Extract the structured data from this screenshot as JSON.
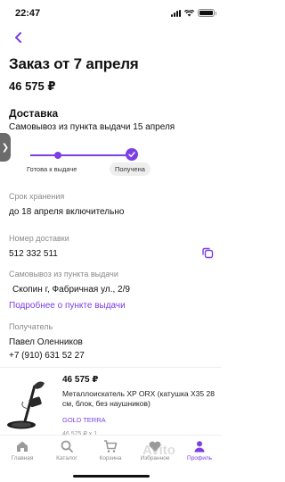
{
  "status_bar": {
    "time": "22:47"
  },
  "header": {
    "title": "Заказ от 7 апреля",
    "total": "46 575 ₽"
  },
  "delivery": {
    "section_title": "Доставка",
    "pickup_line": "Самовывоз из пункта выдачи 15 апреля",
    "steps": [
      {
        "label": "Готова к выдаче",
        "state": "done"
      },
      {
        "label": "Получена",
        "state": "current"
      }
    ],
    "accent_color": "#7b3fe4"
  },
  "storage": {
    "label": "Срок хранения",
    "value": "до 18 апреля включительно"
  },
  "tracking": {
    "label": "Номер доставки",
    "value": "512 332 511"
  },
  "pickup_point": {
    "label": "Самовывоз из пункта выдачи",
    "address": "Скопин г, Фабричная ул., 2/9",
    "link_text": "Подробнее о пункте выдачи"
  },
  "recipient": {
    "label": "Получатель",
    "name": "Павел Оленников",
    "phone": "+7 (910) 631 52 27"
  },
  "product": {
    "price": "46 575 ₽",
    "name": "Металлоискатель XP ORX (катушка X35 28 см, блок, без наушников)",
    "brand": "GOLD TERRA",
    "qty": "46 575 ₽ x 1"
  },
  "tab_bar": {
    "items": [
      {
        "label": "Главная",
        "icon": "home-icon"
      },
      {
        "label": "Каталог",
        "icon": "catalog-icon"
      },
      {
        "label": "Корзина",
        "icon": "cart-icon"
      },
      {
        "label": "Избранное",
        "icon": "heart-icon"
      },
      {
        "label": "Профиль",
        "icon": "profile-icon",
        "active": true
      }
    ]
  },
  "watermark": "Avito"
}
